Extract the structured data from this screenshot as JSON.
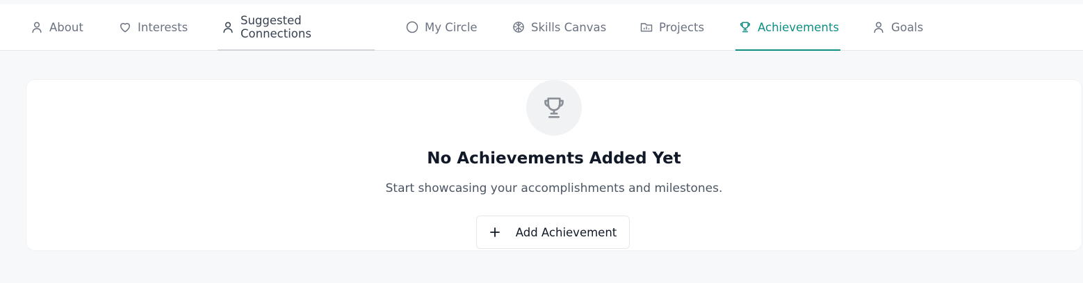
{
  "tabs": [
    {
      "label": "About",
      "icon": "user-icon"
    },
    {
      "label": "Interests",
      "icon": "heart-icon"
    },
    {
      "label": "Suggested Connections",
      "icon": "user-icon"
    },
    {
      "label": "My Circle",
      "icon": "circle-icon"
    },
    {
      "label": "Skills Canvas",
      "icon": "brain-icon"
    },
    {
      "label": "Projects",
      "icon": "folder-chart-icon"
    },
    {
      "label": "Achievements",
      "icon": "trophy-icon"
    },
    {
      "label": "Goals",
      "icon": "user-icon"
    }
  ],
  "active_tab": "Achievements",
  "empty_state": {
    "icon": "trophy-icon",
    "title": "No Achievements Added Yet",
    "subtitle": "Start showcasing your accomplishments and milestones.",
    "button_label": "Add Achievement",
    "button_icon": "plus-icon"
  },
  "colors": {
    "accent": "#0f8f83",
    "background": "#f7f8fa",
    "text_muted": "#6b7280"
  }
}
